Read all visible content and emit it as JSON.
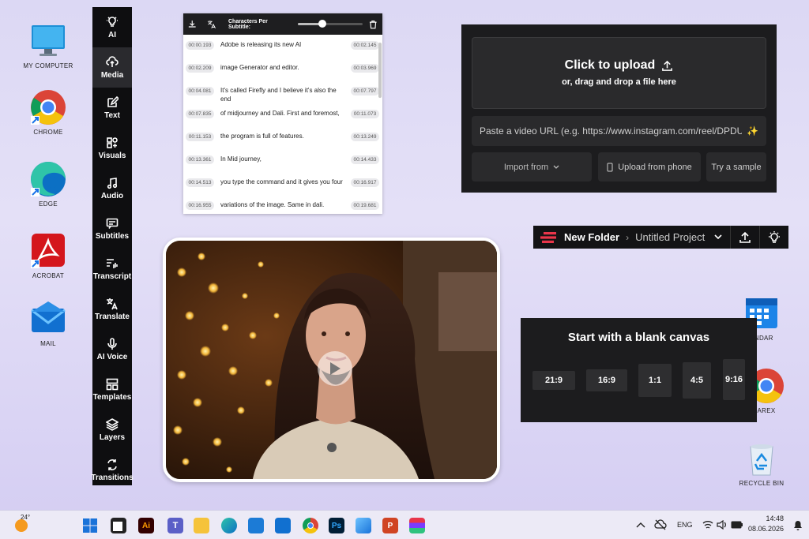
{
  "desktop": {
    "icons_left": [
      {
        "label": "MY COMPUTER",
        "icon": "monitor-icon"
      },
      {
        "label": "CHROME",
        "icon": "chrome-icon"
      },
      {
        "label": "EDGE",
        "icon": "edge-icon"
      },
      {
        "label": "ACROBAT",
        "icon": "acrobat-icon"
      },
      {
        "label": "MAIL",
        "icon": "mail-icon"
      }
    ],
    "icons_right": [
      {
        "label": "ENDAR",
        "icon": "calendar-icon"
      },
      {
        "label": "AREX",
        "icon": "chrome-icon"
      },
      {
        "label": "RECYCLE BIN",
        "icon": "recycle-bin-icon"
      }
    ]
  },
  "sidebar": {
    "items": [
      {
        "label": "AI",
        "icon": "lightbulb-icon"
      },
      {
        "label": "Media",
        "icon": "upload-cloud-icon",
        "active": true
      },
      {
        "label": "Text",
        "icon": "edit-icon"
      },
      {
        "label": "Visuals",
        "icon": "shapes-icon"
      },
      {
        "label": "Audio",
        "icon": "music-note-icon"
      },
      {
        "label": "Subtitles",
        "icon": "subtitles-icon"
      },
      {
        "label": "Transcript",
        "icon": "transcript-icon"
      },
      {
        "label": "Translate",
        "icon": "translate-icon"
      },
      {
        "label": "AI Voice",
        "icon": "microphone-icon"
      },
      {
        "label": "Templates",
        "icon": "templates-icon"
      },
      {
        "label": "Layers",
        "icon": "layers-icon"
      },
      {
        "label": "Transitions",
        "icon": "transitions-icon"
      }
    ]
  },
  "subtitles": {
    "header_label": "Characters Per Subtitle:",
    "slider_value": 0.5,
    "rows": [
      {
        "start": "00:00.193",
        "text": "Adobe is releasing its new AI",
        "end": "00:02.145"
      },
      {
        "start": "00:02.209",
        "text": "image Generator and editor.",
        "end": "00:03.969"
      },
      {
        "start": "00:04.081",
        "text": "It's called Firefly and I believe it's also the end",
        "end": "00:07.797"
      },
      {
        "start": "00:07.835",
        "text": "of midjourney and Dali. First and foremost,",
        "end": "00:11.073"
      },
      {
        "start": "00:11.153",
        "text": "the program is full of features.",
        "end": "00:13.249"
      },
      {
        "start": "00:13.361",
        "text": "In Mid journey,",
        "end": "00:14.433"
      },
      {
        "start": "00:14.513",
        "text": "you type the command and it gives you four",
        "end": "00:16.917"
      },
      {
        "start": "00:16.955",
        "text": "variations of the image. Same in dali.",
        "end": "00:19.681"
      }
    ]
  },
  "upload": {
    "title": "Click to upload",
    "subtitle": "or, drag and drop a file here",
    "url_placeholder": "Paste a video URL (e.g. https://www.instagram.com/reel/DPDU",
    "import_label": "Import from",
    "phone_label": "Upload from phone",
    "sample_label": "Try a sample"
  },
  "project": {
    "folder": "New Folder",
    "name": "Untitled Project"
  },
  "canvas": {
    "title": "Start with a blank canvas",
    "ratios": [
      "21:9",
      "16:9",
      "1:1",
      "4:5",
      "9:16"
    ]
  },
  "taskbar": {
    "weather": "24°",
    "language": "ENG",
    "time": "14:48",
    "date": "08.06.2026"
  },
  "colors": {
    "accent": "#e8354a",
    "panel": "#1c1c1e",
    "sidebar": "#0e0e10"
  }
}
